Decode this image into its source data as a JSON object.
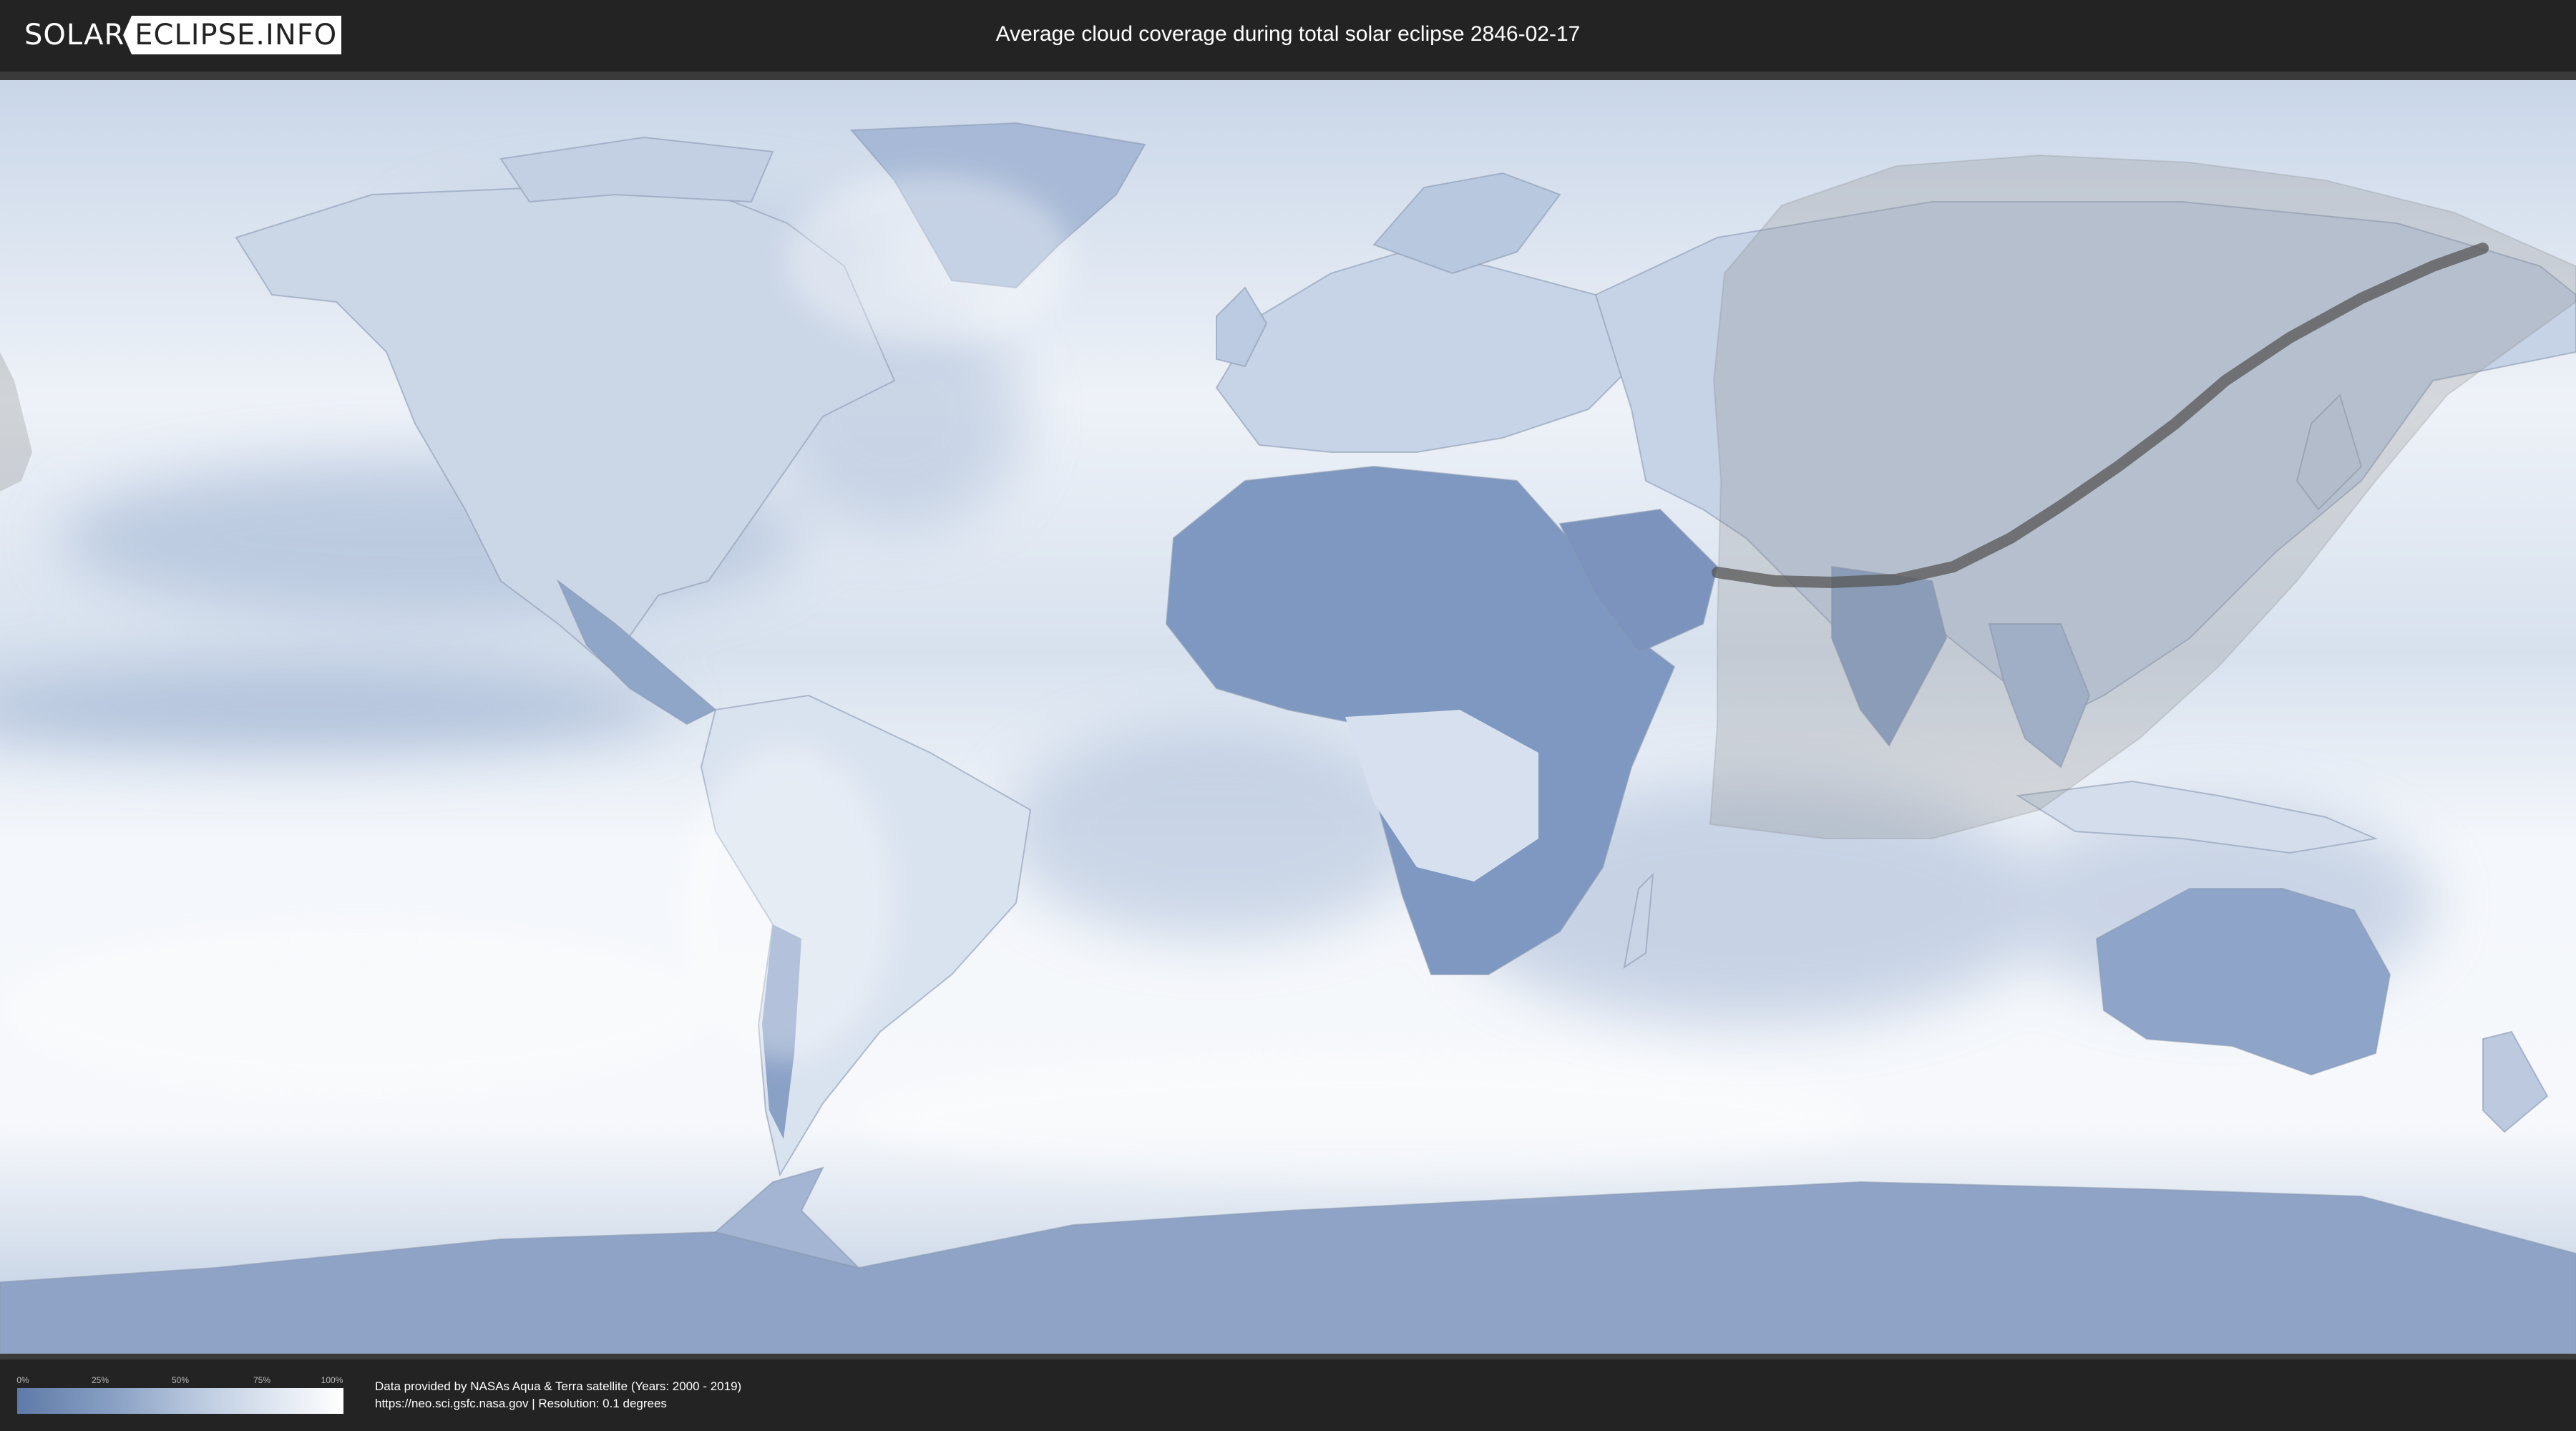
{
  "header": {
    "logo_solar": "SOLAR",
    "logo_eclipse": "ECLIPSE.INFO",
    "title": "Average cloud coverage during total solar eclipse 2846-02-17"
  },
  "legend": {
    "ticks": [
      "0%",
      "25%",
      "50%",
      "75%",
      "100%"
    ],
    "scale_min": 0,
    "scale_max": 100,
    "color_low": "#5e7aa8",
    "color_high": "#ffffff"
  },
  "credits": {
    "line1": "Data provided by NASAs Aqua & Terra satellite (Years: 2000 - 2019)",
    "line2": "https://neo.sci.gsfc.nasa.gov | Resolution: 0.1 degrees"
  },
  "colors": {
    "background": "#232323",
    "ocean_cloud_dense": "#f3f6fa",
    "clear_sky": "#6c87b3",
    "eclipse_overlay": "#8c8c8c",
    "central_path": "#555555"
  }
}
